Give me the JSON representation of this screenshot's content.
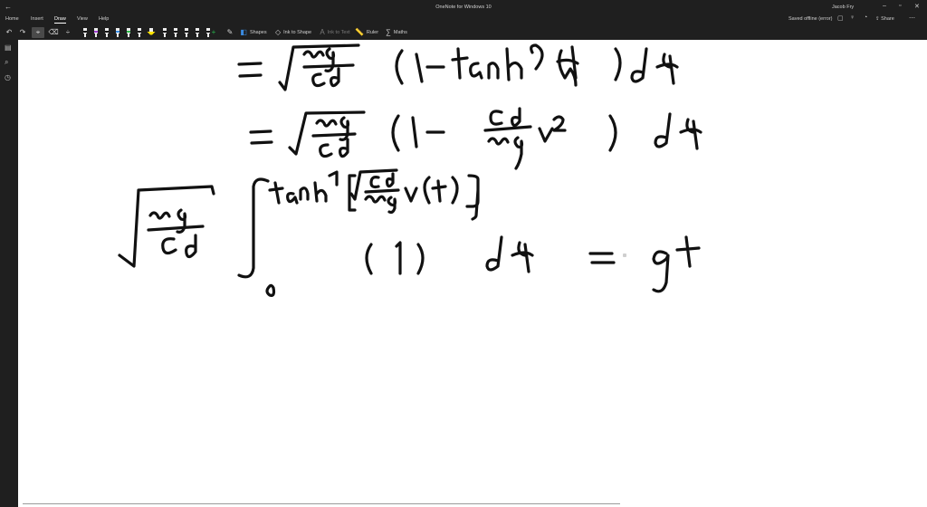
{
  "window": {
    "title": "OneNote for Windows 10",
    "user": "Jacob Fry",
    "controls": [
      "minimize-icon",
      "maximize-icon",
      "close-icon"
    ]
  },
  "menu": {
    "tabs": [
      "Home",
      "Insert",
      "Draw",
      "View",
      "Help"
    ],
    "active_tab": "Draw",
    "saved_status": "Saved offline (error)",
    "share_label": "Share"
  },
  "toolbar": {
    "shapes_label": "Shapes",
    "ink_to_shape_label": "Ink to Shape",
    "ink_to_text_label": "Ink to Text",
    "ruler_label": "Ruler",
    "maths_label": "Maths",
    "pens": [
      {
        "name": "pen-black",
        "color": "#111111"
      },
      {
        "name": "pen-purple",
        "color": "#a040d0"
      },
      {
        "name": "pen-black-2",
        "color": "#111111"
      },
      {
        "name": "pen-blue",
        "color": "#3a8be0"
      },
      {
        "name": "pen-green",
        "color": "#2fb84a"
      },
      {
        "name": "pen-black-3",
        "color": "#111111"
      },
      {
        "name": "highlighter-yellow",
        "color": "#ffe400"
      },
      {
        "name": "pen-black-4",
        "color": "#111111"
      },
      {
        "name": "pen-black-5",
        "color": "#111111"
      },
      {
        "name": "pen-black-6",
        "color": "#111111"
      },
      {
        "name": "pen-black-7",
        "color": "#111111"
      },
      {
        "name": "pen-black-8",
        "color": "#111111"
      }
    ]
  },
  "canvas": {
    "background": "#ffffff",
    "ink_color": "#111111",
    "handwriting": [
      "= ∫ √(mg/Cd) (1 − tanh²(ψ)) dψ",
      "= ∫ √(mg/Cd) (1 − (Cd/mg) v²) dψ",
      "√(mg/Cd) ∫₀^{tanh⁻¹[√(Cd/mg) v(t)]} (1) dψ = gt"
    ]
  }
}
